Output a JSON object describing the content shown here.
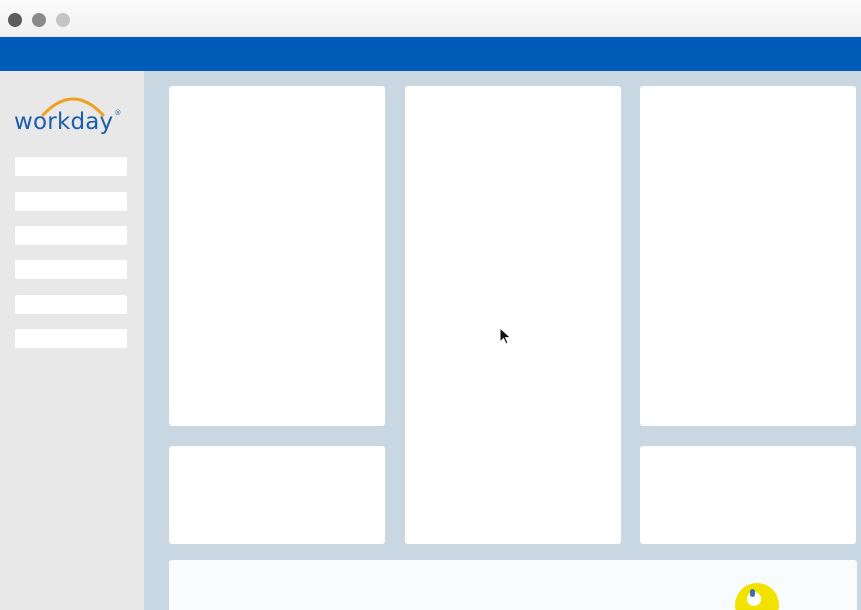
{
  "window": {
    "controls": [
      "close",
      "minimize",
      "maximize"
    ]
  },
  "brand": {
    "logo_text": "workday",
    "logo_mark": "®",
    "colors": {
      "topbar": "#005cb9",
      "logo_text": "#1d5eaa",
      "logo_arc": "#f0a020",
      "content_bg": "#c9d7e3",
      "badge": "#f2e200"
    }
  },
  "sidebar": {
    "items": [
      {
        "label": ""
      },
      {
        "label": ""
      },
      {
        "label": ""
      },
      {
        "label": ""
      },
      {
        "label": ""
      },
      {
        "label": ""
      }
    ]
  },
  "icons": {
    "cursor": "mouse-pointer-icon",
    "badge": "assistant-badge-icon"
  }
}
